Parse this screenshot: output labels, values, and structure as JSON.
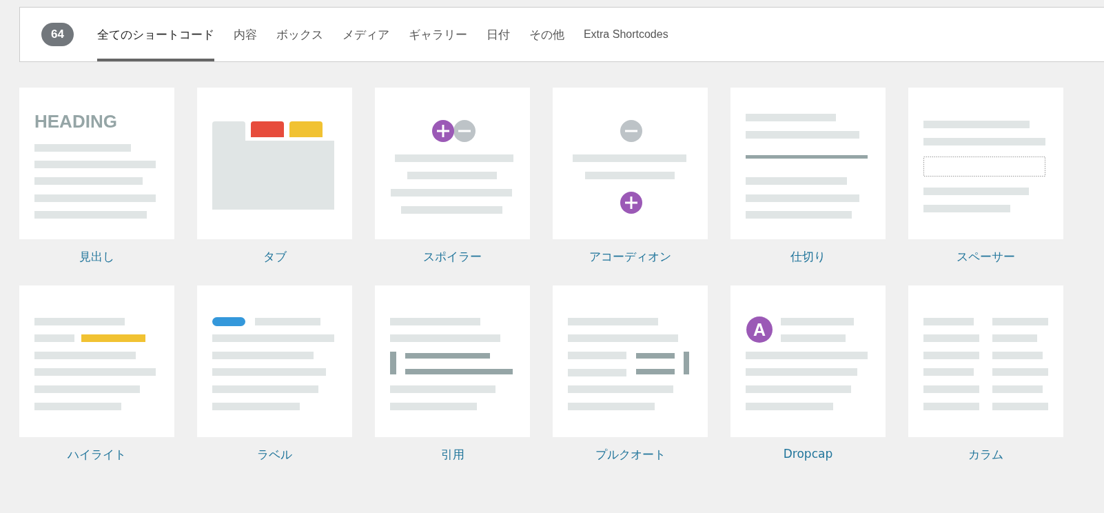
{
  "header": {
    "count": "64",
    "tabs": [
      {
        "label": "全てのショートコード",
        "selected": true
      },
      {
        "label": "内容",
        "selected": false
      },
      {
        "label": "ボックス",
        "selected": false
      },
      {
        "label": "メディア",
        "selected": false
      },
      {
        "label": "ギャラリー",
        "selected": false
      },
      {
        "label": "日付",
        "selected": false
      },
      {
        "label": "その他",
        "selected": false
      },
      {
        "label": "Extra Shortcodes",
        "selected": false
      }
    ]
  },
  "shortcodes": [
    {
      "kind": "heading",
      "label": "見出し",
      "sample": "HEADING"
    },
    {
      "kind": "tabs",
      "label": "タブ"
    },
    {
      "kind": "spoiler",
      "label": "スポイラー"
    },
    {
      "kind": "accordion",
      "label": "アコーディオン"
    },
    {
      "kind": "divider",
      "label": "仕切り"
    },
    {
      "kind": "spacer",
      "label": "スペーサー"
    },
    {
      "kind": "highlight",
      "label": "ハイライト"
    },
    {
      "kind": "label",
      "label": "ラベル"
    },
    {
      "kind": "quote",
      "label": "引用"
    },
    {
      "kind": "pullquote",
      "label": "プルクオート"
    },
    {
      "kind": "dropcap",
      "label": "Dropcap",
      "sample": "A"
    },
    {
      "kind": "columns",
      "label": "カラム"
    }
  ]
}
